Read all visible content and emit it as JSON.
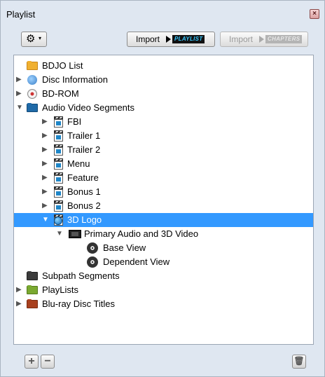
{
  "window": {
    "title": "Playlist"
  },
  "toolbar": {
    "import_playlist": {
      "label": "Import",
      "badge": "PLAYLIST"
    },
    "import_chapters": {
      "label": "Import",
      "badge": "CHAPTERS"
    }
  },
  "tree": {
    "items": [
      {
        "label": "BDJO List"
      },
      {
        "label": "Disc Information"
      },
      {
        "label": "BD-ROM"
      },
      {
        "label": "Audio Video Segments"
      },
      {
        "label": "FBI"
      },
      {
        "label": "Trailer 1"
      },
      {
        "label": "Trailer 2"
      },
      {
        "label": "Menu"
      },
      {
        "label": "Feature"
      },
      {
        "label": "Bonus 1"
      },
      {
        "label": "Bonus 2"
      },
      {
        "label": "3D Logo",
        "selected": true
      },
      {
        "label": "Primary Audio and 3D Video"
      },
      {
        "label": "Base View"
      },
      {
        "label": "Dependent View"
      },
      {
        "label": "Subpath Segments"
      },
      {
        "label": "PlayLists"
      },
      {
        "label": "Blu-ray Disc Titles"
      }
    ]
  },
  "colors": {
    "selection": "#3399ff",
    "panel_bg": "#dfe7f1"
  }
}
